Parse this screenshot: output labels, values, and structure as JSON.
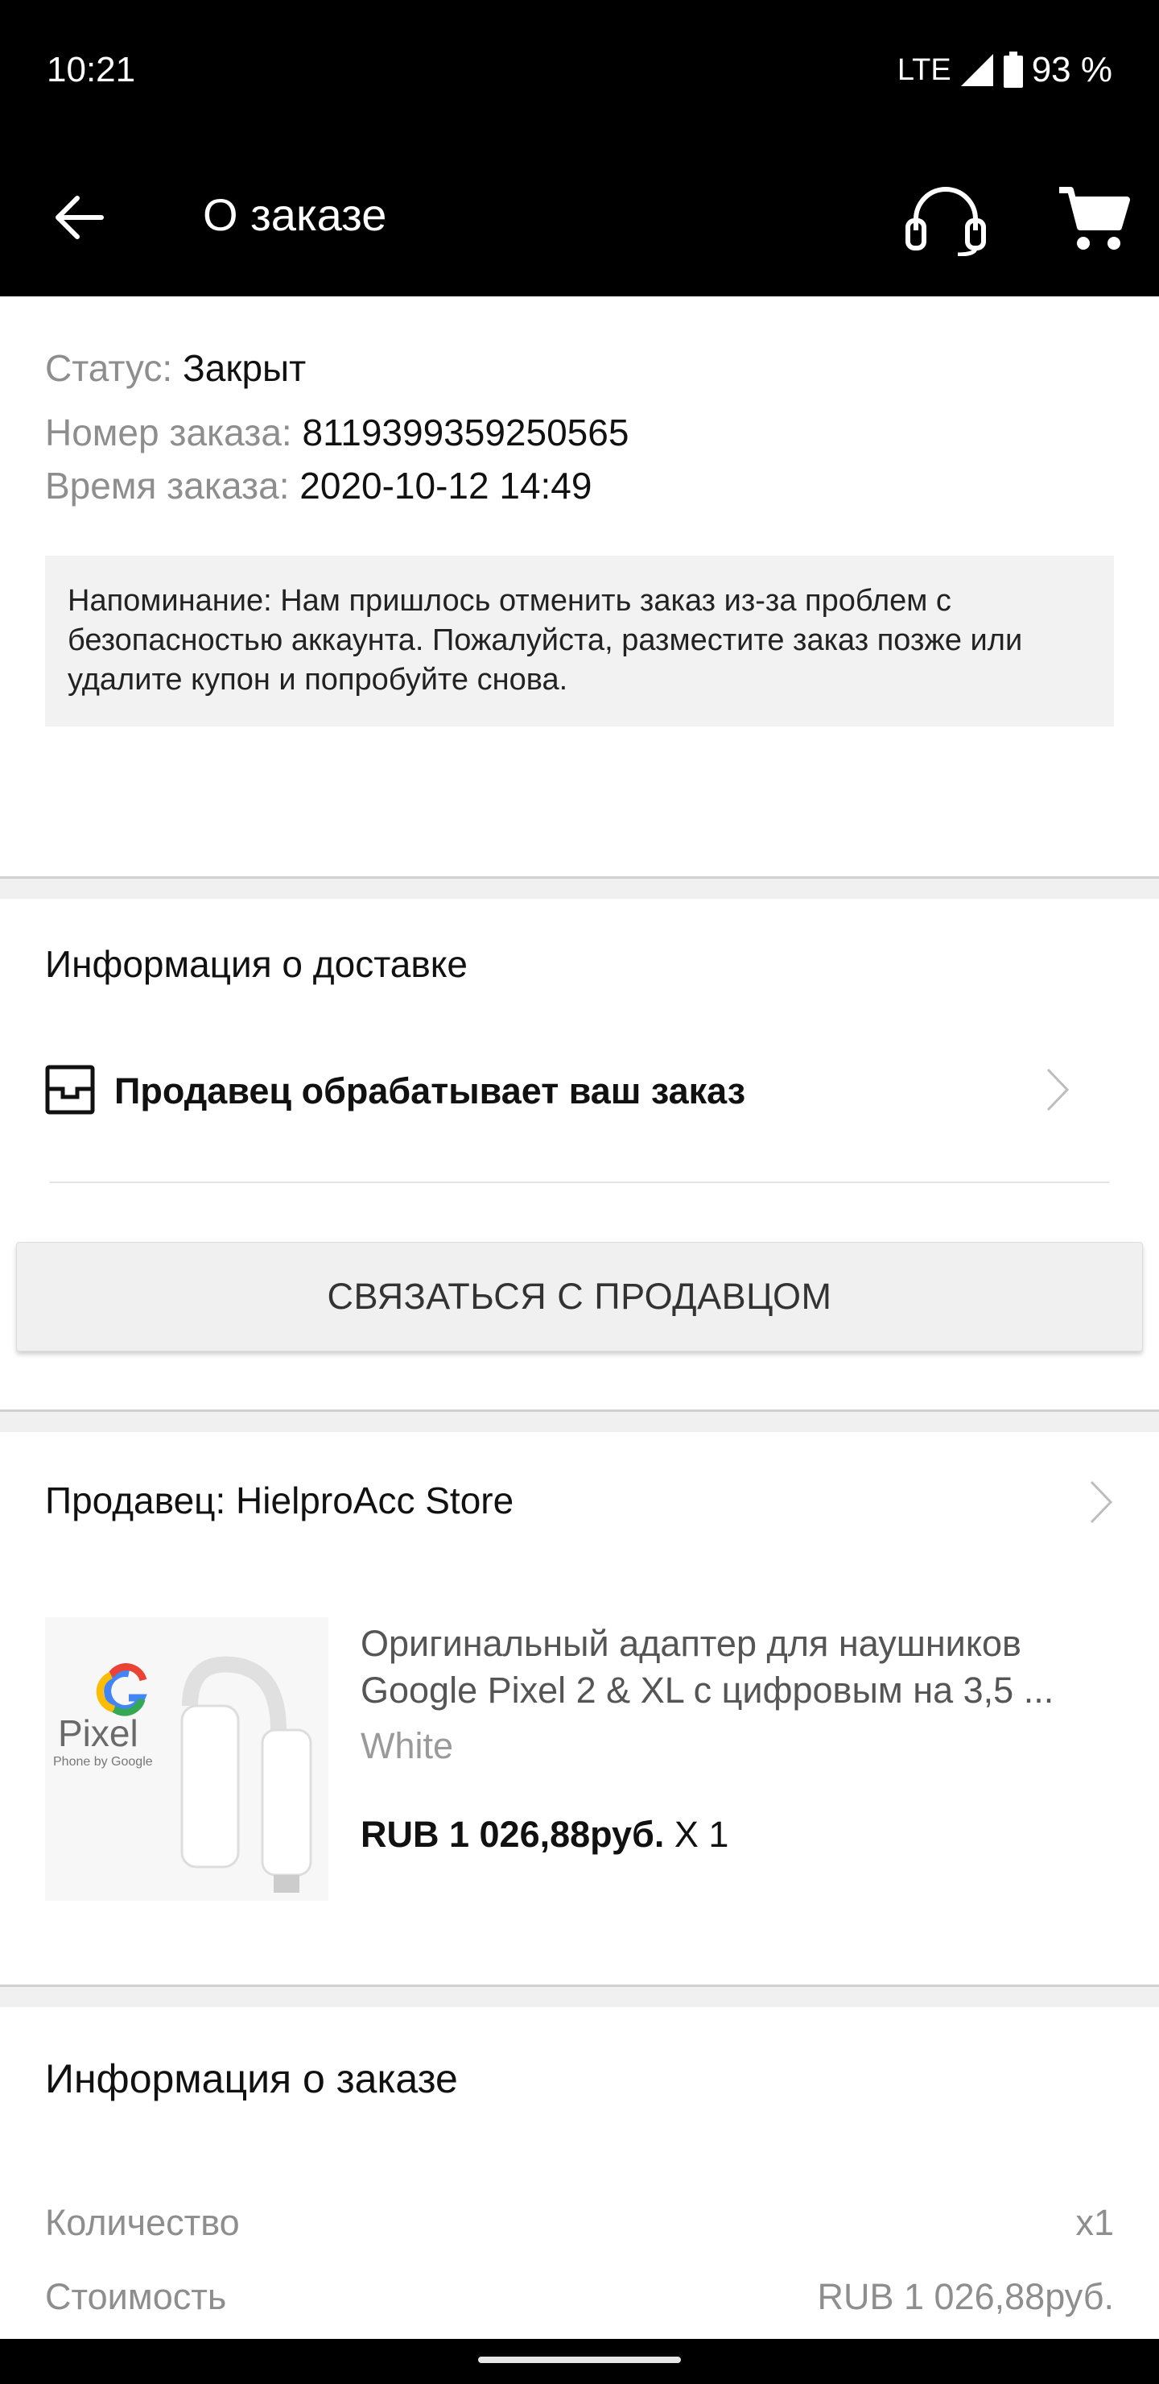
{
  "status_bar": {
    "time": "10:21",
    "network": "LTE",
    "battery": "93 %"
  },
  "app_bar": {
    "title": "О заказе",
    "back_icon": "arrow-left-icon",
    "support_icon": "headset-icon",
    "cart_icon": "cart-icon"
  },
  "order": {
    "status_label": "Статус:",
    "status_value": "Закрыт",
    "number_label": "Номер заказа:",
    "number_value": "8119399359250565",
    "time_label": "Время заказа:",
    "time_value": "2020-10-12 14:49",
    "notice": "Напоминание: Нам пришлось отменить заказ из-за проблем с безопасностью аккаунта. Пожалуйста, разместите заказ позже или удалите купон и попробуйте снова."
  },
  "delivery": {
    "title": "Информация о доставке",
    "status_text": "Продавец обрабатывает ваш заказ",
    "contact_button": "СВЯЗАТЬСЯ С ПРОДАВЦОМ"
  },
  "seller": {
    "label": "Продавец: HielproAcc Store",
    "product": {
      "title": "Оригинальный адаптер для наушников Google Pixel 2 & XL с цифровым на 3,5 ...",
      "variant": "White",
      "price": "RUB 1 026,88руб.",
      "quantity": "X 1",
      "image_brand": "Pixel",
      "image_subtitle": "Phone by Google"
    }
  },
  "order_info": {
    "title": "Информация о заказе",
    "quantity_label": "Количество",
    "quantity_value": "x1",
    "cost_label": "Стоимость",
    "cost_value": "RUB 1 026,88руб."
  },
  "colors": {
    "bar_background": "#000000",
    "divider": "#f0f0f0",
    "notice_background": "#f2f2f2",
    "muted_text": "#8e8e8e"
  }
}
